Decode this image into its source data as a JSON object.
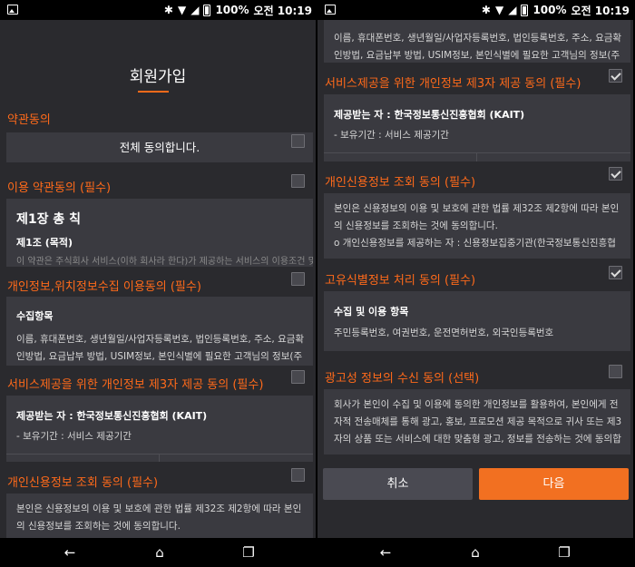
{
  "status": {
    "battery": "100%",
    "time": "오전 10:19"
  },
  "page_title": "회원가입",
  "agree_all": {
    "section": "약관동의",
    "label": "전체 동의합니다."
  },
  "terms_use": {
    "title": "이용 약관동의 (필수)",
    "chapter": "제1장 총 칙",
    "article": "제1조 (목적)",
    "cut_line": "이 약관은 주식회사 서비스(이하 회사라 한다)가 제공하는 서비스의 이용조건 및"
  },
  "privacy_location": {
    "title": "개인정보,위치정보수집 이용동의 (필수)",
    "heading": "수집항목",
    "line1": "이름, 휴대폰번호, 생년월일/사업자등록번호, 법인등록번호, 주소, 요금확",
    "line2": "인방법, 요금납부 방법, USIM정보, 본인식별에 필요한 고객님의 정보(주"
  },
  "third_party": {
    "title": "서비스제공을 위한 개인정보 제3자 제공 동의 (필수)",
    "recipient": "제공받는 자 : 한국정보통신진흥협회 (KAIT)",
    "retention": "- 보유기간 : 서비스 제공기간"
  },
  "credit_info": {
    "title": "개인신용정보 조회 동의 (필수)",
    "line1": "본인은 신용정보의 이용 및 보호에 관한 법률 제32조 제2항에 따라 본인",
    "line2": "의 신용정보를 조회하는 것에 동의합니다.",
    "line3": "o 개인신용정보를 제공하는 자 : 신용정보집중기관(한국정보통신진흥협"
  },
  "unique_id": {
    "title": "고유식별정보 처리 동의 (필수)",
    "heading": "수집 및 이용 항목",
    "items": "주민등록번호, 여권번호, 운전면허번호, 외국인등록번호"
  },
  "marketing": {
    "title": "광고성 정보의 수신 동의 (선택)",
    "line1": "회사가 본인이 수집 및 이용에 동의한 개인정보를 활용하여, 본인에게 전",
    "line2": "자적 전송매체를 통해 광고, 홍보, 프로모션 제공 목적으로 귀사 또는 제3",
    "line3": "자의 상품 또는 서비스에 대한 맞춤형 광고, 정보를 전송하는 것에 동의합"
  },
  "buttons": {
    "cancel": "취소",
    "next": "다음"
  },
  "icons": {
    "gallery": "gallery-icon",
    "bluetooth": "bluetooth-icon",
    "wifi": "wifi-icon",
    "signal": "signal-icon",
    "battery": "battery-icon",
    "back": "back-icon",
    "home": "home-icon",
    "recents": "recents-icon"
  },
  "colors": {
    "accent": "#f27021",
    "background": "#2a2a2e",
    "box": "#3a3a40"
  }
}
